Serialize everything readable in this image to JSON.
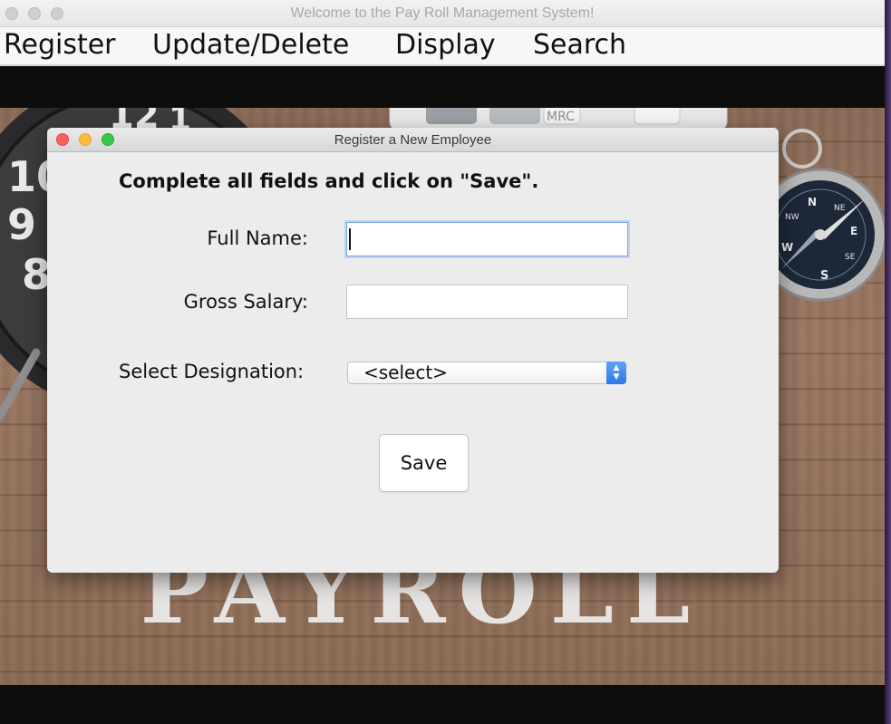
{
  "main_window": {
    "title": "Welcome to the Pay Roll Management System!",
    "menu": [
      "Register",
      "Update/Delete",
      "Display",
      "Search"
    ]
  },
  "background": {
    "watermark_text": "PAYROLL",
    "clock_digits": [
      "10",
      "9",
      "8",
      "12",
      "1"
    ],
    "calculator_key": "MRC",
    "compass_letters": [
      "N",
      "NE",
      "E",
      "SE",
      "S",
      "NW",
      "W"
    ]
  },
  "dialog": {
    "title": "Register a New Employee",
    "instructions": "Complete all fields and click on \"Save\".",
    "full_name_label": "Full Name:",
    "full_name_value": "",
    "gross_salary_label": "Gross Salary:",
    "gross_salary_value": "",
    "designation_label": "Select Designation:",
    "designation_selected": "<select>",
    "save_label": "Save"
  },
  "colors": {
    "focus_ring": "#7aa8e0",
    "select_stepper": "#2f78e6",
    "close_button": "#fc605c",
    "minimize_button": "#fdbc40",
    "zoom_button": "#34c84a"
  }
}
